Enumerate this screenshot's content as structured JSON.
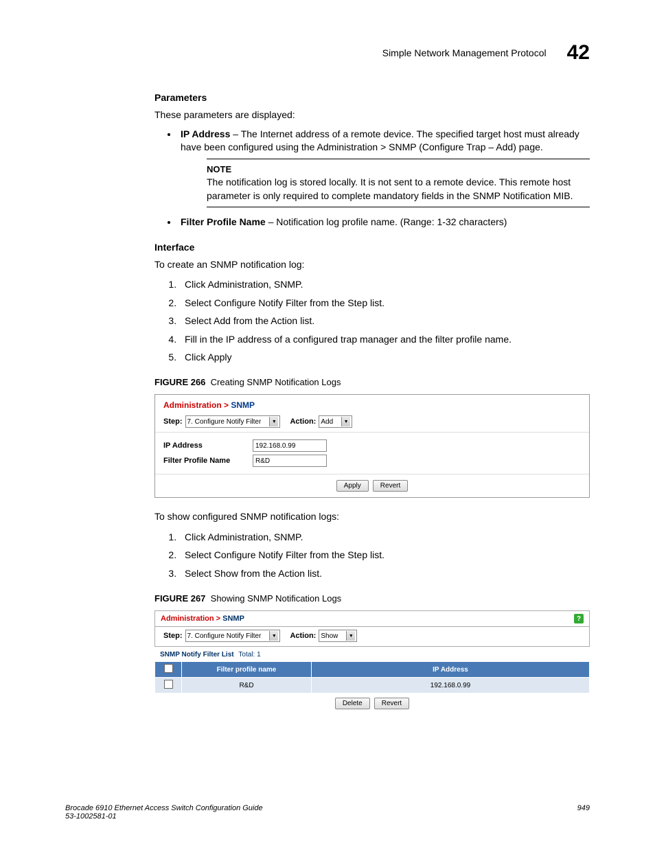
{
  "header": {
    "title": "Simple Network Management Protocol",
    "chapter": "42"
  },
  "sec_parameters": {
    "title": "Parameters",
    "lead": "These parameters are displayed:",
    "ip_label": "IP Address",
    "ip_text": " – The Internet address of a remote device. The specified target host must already have been configured using the Administration > SNMP (Configure Trap – Add) page.",
    "note_title": "NOTE",
    "note_text": "The notification log is stored locally. It is not sent to a remote device. This remote host parameter is only required to complete mandatory fields in the SNMP Notification MIB.",
    "fpn_label": "Filter Profile Name",
    "fpn_text": " – Notification log profile name. (Range: 1-32 characters)"
  },
  "sec_interface": {
    "title": "Interface",
    "lead": "To create an SNMP notification log:",
    "steps": [
      "Click Administration, SNMP.",
      "Select Configure Notify Filter from the Step list.",
      "Select Add from the Action list.",
      "Fill in the IP address of a configured trap manager and the filter profile name.",
      "Click Apply"
    ]
  },
  "fig266": {
    "caption_prefix": "FIGURE 266",
    "caption_text": "Creating SNMP Notification Logs",
    "breadcrumb_adm": "Administration > ",
    "breadcrumb_snmp": "SNMP",
    "step_label": "Step:",
    "step_value": "7. Configure Notify Filter",
    "action_label": "Action:",
    "action_value": "Add",
    "ip_label": "IP Address",
    "ip_value": "192.168.0.99",
    "fpn_label": "Filter Profile Name",
    "fpn_value": "R&D",
    "apply": "Apply",
    "revert": "Revert"
  },
  "post266": {
    "lead": "To show configured SNMP notification logs:",
    "steps": [
      "Click Administration, SNMP.",
      "Select Configure Notify Filter from the Step list.",
      "Select Show from the Action list."
    ]
  },
  "fig267": {
    "caption_prefix": "FIGURE 267",
    "caption_text": "Showing SNMP Notification Logs",
    "breadcrumb_adm": "Administration > ",
    "breadcrumb_snmp": "SNMP",
    "step_label": "Step:",
    "step_value": "7. Configure Notify Filter",
    "action_label": "Action:",
    "action_value": "Show",
    "list_title": "SNMP Notify Filter List",
    "total_label": "Total: 1",
    "cols": {
      "fpn": "Filter profile name",
      "ip": "IP Address"
    },
    "rows": [
      {
        "fpn": "R&D",
        "ip": "192.168.0.99"
      }
    ],
    "delete": "Delete",
    "revert": "Revert",
    "help": "?"
  },
  "footer": {
    "left1": "Brocade 6910 Ethernet Access Switch Configuration Guide",
    "left2": "53-1002581-01",
    "right": "949"
  }
}
